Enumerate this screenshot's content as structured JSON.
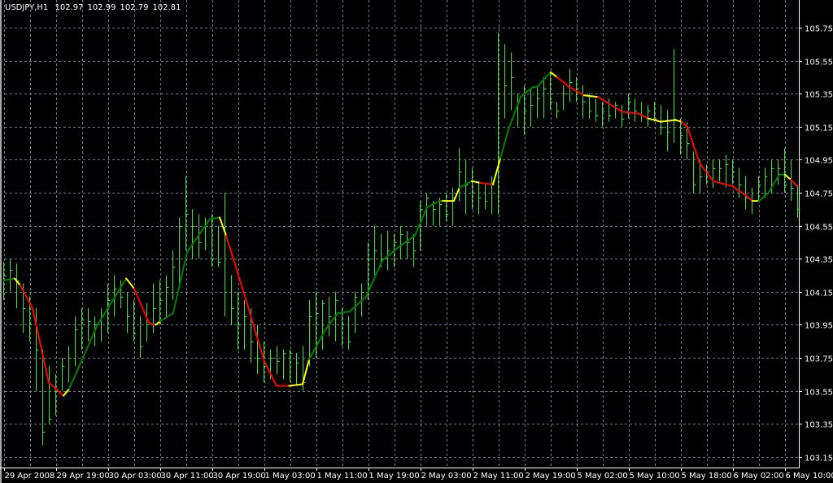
{
  "header": {
    "symbol": "USDJPY,H1",
    "open": "102.97",
    "high": "102.99",
    "low": "102.79",
    "close": "102.81"
  },
  "colors": {
    "background": "#000000",
    "grid": "#6b7a8c",
    "bars": "#32e632",
    "ma_up": "#008000",
    "ma_down": "#ff0000",
    "ma_flat": "#ffff00",
    "axis": "#ffffff"
  },
  "chart_data": {
    "type": "ohlc",
    "title": "USDJPY,H1",
    "ylim": [
      103.15,
      105.75
    ],
    "price_ticks": [
      "105.75",
      "105.55",
      "105.35",
      "105.15",
      "104.95",
      "104.75",
      "104.55",
      "104.35",
      "104.15",
      "103.95",
      "103.75",
      "103.55",
      "103.35",
      "103.15"
    ],
    "time_ticks": [
      {
        "bar": 0,
        "label": "29 Apr 2008"
      },
      {
        "bar": 8,
        "label": "29 Apr 19:00"
      },
      {
        "bar": 16,
        "label": "30 Apr 03:00"
      },
      {
        "bar": 24,
        "label": "30 Apr 11:00"
      },
      {
        "bar": 32,
        "label": "30 Apr 19:00"
      },
      {
        "bar": 40,
        "label": "1 May 03:00"
      },
      {
        "bar": 48,
        "label": "1 May 11:00"
      },
      {
        "bar": 56,
        "label": "1 May 19:00"
      },
      {
        "bar": 64,
        "label": "2 May 03:00"
      },
      {
        "bar": 72,
        "label": "2 May 11:00"
      },
      {
        "bar": 80,
        "label": "2 May 19:00"
      },
      {
        "bar": 88,
        "label": "5 May 02:00"
      },
      {
        "bar": 96,
        "label": "5 May 10:00"
      },
      {
        "bar": 104,
        "label": "5 May 18:00"
      },
      {
        "bar": 112,
        "label": "6 May 02:00"
      },
      {
        "bar": 120,
        "label": "6 May 10:00"
      }
    ],
    "bars_hlc": [
      [
        104.33,
        104.1,
        104.25
      ],
      [
        104.35,
        104.15,
        104.28
      ],
      [
        104.32,
        104.05,
        104.22
      ],
      [
        104.2,
        103.9,
        104.05
      ],
      [
        104.12,
        103.85,
        103.95
      ],
      [
        104.05,
        103.55,
        103.8
      ],
      [
        103.8,
        103.22,
        103.3
      ],
      [
        103.7,
        103.35,
        103.38
      ],
      [
        103.65,
        103.4,
        103.55
      ],
      [
        103.75,
        103.55,
        103.7
      ],
      [
        103.82,
        103.6,
        103.75
      ],
      [
        104.0,
        103.7,
        103.92
      ],
      [
        104.05,
        103.8,
        103.98
      ],
      [
        104.05,
        103.85,
        103.97
      ],
      [
        104.0,
        103.82,
        103.95
      ],
      [
        104.05,
        103.85,
        104.0
      ],
      [
        104.2,
        103.9,
        104.1
      ],
      [
        104.25,
        104.0,
        104.17
      ],
      [
        104.22,
        104.05,
        104.12
      ],
      [
        104.15,
        103.9,
        104.0
      ],
      [
        104.1,
        103.85,
        103.9
      ],
      [
        104.0,
        103.75,
        103.82
      ],
      [
        104.08,
        103.85,
        103.95
      ],
      [
        104.2,
        103.9,
        104.05
      ],
      [
        104.22,
        103.95,
        104.1
      ],
      [
        104.25,
        104.0,
        104.18
      ],
      [
        104.4,
        104.1,
        104.3
      ],
      [
        104.6,
        104.2,
        104.55
      ],
      [
        104.85,
        104.4,
        104.62
      ],
      [
        104.65,
        104.35,
        104.55
      ],
      [
        104.62,
        104.35,
        104.45
      ],
      [
        104.6,
        104.4,
        104.55
      ],
      [
        104.62,
        104.3,
        104.35
      ],
      [
        104.55,
        104.3,
        104.33
      ],
      [
        104.75,
        104.0,
        104.15
      ],
      [
        104.25,
        103.95,
        104.05
      ],
      [
        104.15,
        103.8,
        103.95
      ],
      [
        104.1,
        103.8,
        104.0
      ],
      [
        104.05,
        103.72,
        103.85
      ],
      [
        103.95,
        103.65,
        103.75
      ],
      [
        103.85,
        103.6,
        103.7
      ],
      [
        103.8,
        103.62,
        103.75
      ],
      [
        103.82,
        103.65,
        103.73
      ],
      [
        103.8,
        103.62,
        103.78
      ],
      [
        103.8,
        103.6,
        103.78
      ],
      [
        103.78,
        103.58,
        103.72
      ],
      [
        103.82,
        103.55,
        103.6
      ],
      [
        104.1,
        103.7,
        104.0
      ],
      [
        104.15,
        103.75,
        104.02
      ],
      [
        104.1,
        103.8,
        104.08
      ],
      [
        104.12,
        103.88,
        104.0
      ],
      [
        104.15,
        103.85,
        104.1
      ],
      [
        104.05,
        103.82,
        103.95
      ],
      [
        104.0,
        103.8,
        103.85
      ],
      [
        104.15,
        103.9,
        104.12
      ],
      [
        104.2,
        104.0,
        104.15
      ],
      [
        104.45,
        104.1,
        104.35
      ],
      [
        104.55,
        104.25,
        104.4
      ],
      [
        104.5,
        104.3,
        104.35
      ],
      [
        104.52,
        104.28,
        104.4
      ],
      [
        104.5,
        104.3,
        104.45
      ],
      [
        104.55,
        104.35,
        104.5
      ],
      [
        104.52,
        104.35,
        104.45
      ],
      [
        104.5,
        104.3,
        104.4
      ],
      [
        104.7,
        104.4,
        104.65
      ],
      [
        104.75,
        104.55,
        104.72
      ],
      [
        104.7,
        104.55,
        104.65
      ],
      [
        104.72,
        104.55,
        104.68
      ],
      [
        104.75,
        104.58,
        104.62
      ],
      [
        104.78,
        104.55,
        104.72
      ],
      [
        105.02,
        104.7,
        104.88
      ],
      [
        104.95,
        104.62,
        104.8
      ],
      [
        104.9,
        104.65,
        104.75
      ],
      [
        104.82,
        104.62,
        104.72
      ],
      [
        104.8,
        104.65,
        104.7
      ],
      [
        104.85,
        104.62,
        104.8
      ],
      [
        105.72,
        104.62,
        105.35
      ],
      [
        105.65,
        105.2,
        105.4
      ],
      [
        105.6,
        105.25,
        105.45
      ],
      [
        105.35,
        105.15,
        105.3
      ],
      [
        105.4,
        105.1,
        105.25
      ],
      [
        105.38,
        105.15,
        105.28
      ],
      [
        105.4,
        105.2,
        105.32
      ],
      [
        105.45,
        105.2,
        105.38
      ],
      [
        105.48,
        105.25,
        105.3
      ],
      [
        105.3,
        105.2,
        105.25
      ],
      [
        105.4,
        105.25,
        105.35
      ],
      [
        105.5,
        105.3,
        105.42
      ],
      [
        105.45,
        105.3,
        105.38
      ],
      [
        105.4,
        105.2,
        105.3
      ],
      [
        105.35,
        105.2,
        105.25
      ],
      [
        105.32,
        105.18,
        105.22
      ],
      [
        105.3,
        105.15,
        105.25
      ],
      [
        105.32,
        105.18,
        105.22
      ],
      [
        105.3,
        105.2,
        105.28
      ],
      [
        105.28,
        105.15,
        105.2
      ],
      [
        105.35,
        105.2,
        105.3
      ],
      [
        105.32,
        105.18,
        105.25
      ],
      [
        105.3,
        105.18,
        105.22
      ],
      [
        105.28,
        105.15,
        105.25
      ],
      [
        105.3,
        105.18,
        105.2
      ],
      [
        105.28,
        105.1,
        105.15
      ],
      [
        105.25,
        105.0,
        105.12
      ],
      [
        105.62,
        105.05,
        105.2
      ],
      [
        105.2,
        104.98,
        105.1
      ],
      [
        105.18,
        104.95,
        105.05
      ],
      [
        105.0,
        104.75,
        104.8
      ],
      [
        104.95,
        104.75,
        104.85
      ],
      [
        104.92,
        104.8,
        104.88
      ],
      [
        104.95,
        104.78,
        104.9
      ],
      [
        104.95,
        104.82,
        104.9
      ],
      [
        104.98,
        104.78,
        104.92
      ],
      [
        104.95,
        104.8,
        104.88
      ],
      [
        104.9,
        104.72,
        104.8
      ],
      [
        104.85,
        104.65,
        104.72
      ],
      [
        104.78,
        104.62,
        104.7
      ],
      [
        104.85,
        104.7,
        104.8
      ],
      [
        104.9,
        104.72,
        104.85
      ],
      [
        104.95,
        104.75,
        104.9
      ],
      [
        104.95,
        104.8,
        104.9
      ],
      [
        105.02,
        104.75,
        104.8
      ],
      [
        104.95,
        104.7,
        104.78
      ],
      [
        104.8,
        104.6,
        104.65
      ]
    ],
    "ma_points": [
      [
        0.1,
        104.22,
        "up"
      ],
      [
        1.75,
        104.23,
        "flat"
      ],
      [
        2.6,
        104.19,
        "down"
      ],
      [
        4.5,
        104.05,
        "down"
      ],
      [
        7,
        103.6,
        "down"
      ],
      [
        9.25,
        103.52,
        "flat"
      ],
      [
        10.1,
        103.56,
        "up"
      ],
      [
        14.5,
        103.95,
        "up"
      ],
      [
        18.9,
        104.23,
        "flat"
      ],
      [
        20.1,
        104.17,
        "down"
      ],
      [
        22.4,
        103.96,
        "down"
      ],
      [
        23.4,
        103.95,
        "flat"
      ],
      [
        24.1,
        103.97,
        "up"
      ],
      [
        26.1,
        104.02,
        "up"
      ],
      [
        28.25,
        104.39,
        "up"
      ],
      [
        31.75,
        104.59,
        "up"
      ],
      [
        33.25,
        104.6,
        "flat"
      ],
      [
        34.25,
        104.49,
        "down"
      ],
      [
        37,
        104.14,
        "down"
      ],
      [
        40.1,
        103.73,
        "down"
      ],
      [
        42,
        103.58,
        "down"
      ],
      [
        43.9,
        103.58,
        "flat"
      ],
      [
        46,
        103.59,
        "flat"
      ],
      [
        47,
        103.74,
        "up"
      ],
      [
        49.5,
        103.92,
        "up"
      ],
      [
        51.4,
        104.02,
        "up"
      ],
      [
        53.25,
        104.03,
        "up"
      ],
      [
        55.75,
        104.12,
        "up"
      ],
      [
        58.25,
        104.34,
        "up"
      ],
      [
        60.75,
        104.42,
        "up"
      ],
      [
        63.25,
        104.49,
        "up"
      ],
      [
        65.1,
        104.66,
        "up"
      ],
      [
        67,
        104.7,
        "up"
      ],
      [
        67.5,
        104.7,
        "flat"
      ],
      [
        69.25,
        104.7,
        "flat"
      ],
      [
        70.1,
        104.78,
        "up"
      ],
      [
        72,
        104.82,
        "flat"
      ],
      [
        73.25,
        104.81,
        "down"
      ],
      [
        75.25,
        104.8,
        "flat"
      ],
      [
        76.4,
        104.96,
        "up"
      ],
      [
        77.6,
        105.13,
        "up"
      ],
      [
        79.5,
        105.33,
        "up"
      ],
      [
        81.4,
        105.39,
        "up"
      ],
      [
        82,
        105.39,
        "up"
      ],
      [
        84.1,
        105.48,
        "flat"
      ],
      [
        85.1,
        105.45,
        "down"
      ],
      [
        87,
        105.39,
        "down"
      ],
      [
        89.25,
        105.34,
        "flat"
      ],
      [
        91.4,
        105.33,
        "down"
      ],
      [
        95.1,
        105.24,
        "down"
      ],
      [
        97.6,
        105.23,
        "down"
      ],
      [
        99.1,
        105.2,
        "flat"
      ],
      [
        101,
        105.18,
        "flat"
      ],
      [
        103.25,
        105.19,
        "flat"
      ],
      [
        104.25,
        105.18,
        "down"
      ],
      [
        105.1,
        105.15,
        "down"
      ],
      [
        107,
        104.93,
        "down"
      ],
      [
        109.1,
        104.82,
        "down"
      ],
      [
        112,
        104.79,
        "down"
      ],
      [
        114.25,
        104.73,
        "down"
      ],
      [
        115.1,
        104.7,
        "flat"
      ],
      [
        116.1,
        104.7,
        "up"
      ],
      [
        117.6,
        104.75,
        "up"
      ],
      [
        119.25,
        104.86,
        "up"
      ],
      [
        120.1,
        104.86,
        "flat"
      ],
      [
        121,
        104.83,
        "down"
      ],
      [
        122,
        104.79,
        "down"
      ]
    ]
  }
}
